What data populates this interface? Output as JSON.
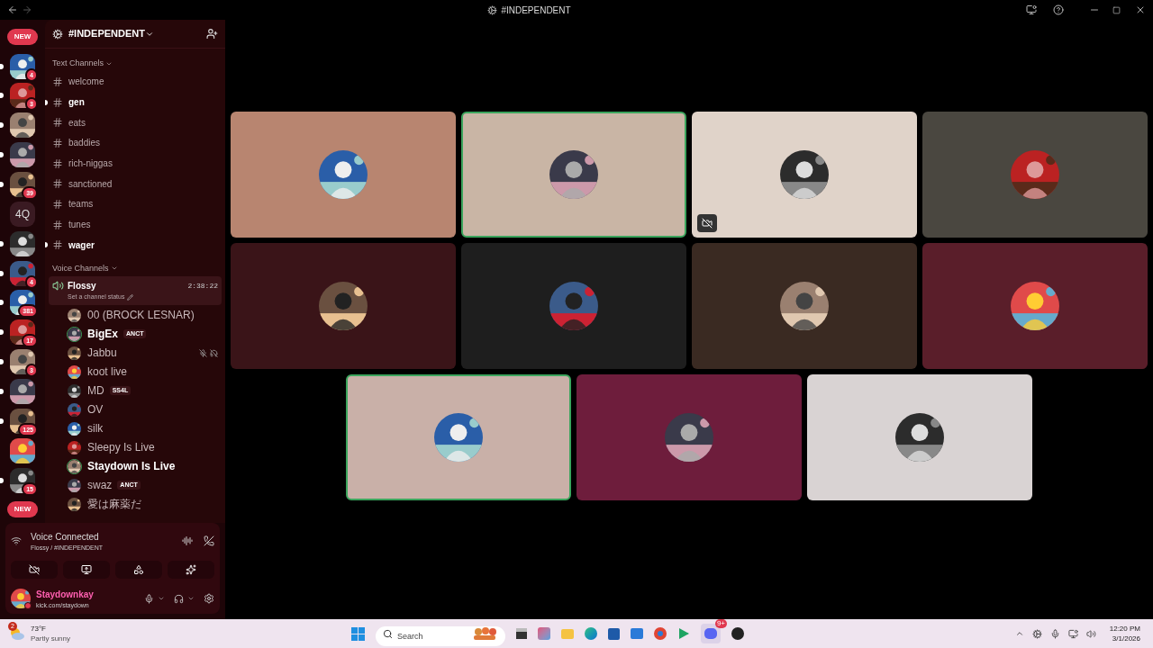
{
  "window": {
    "title": "#INDEPENDENT"
  },
  "servers": [
    {
      "kind": "pill",
      "label": "NEW",
      "unread": false
    },
    {
      "kind": "avatar",
      "badge": "4",
      "unread": true
    },
    {
      "kind": "avatar",
      "badge": "3",
      "unread": true
    },
    {
      "kind": "avatar",
      "unread": true
    },
    {
      "kind": "avatar",
      "unread": true
    },
    {
      "kind": "avatar",
      "badge": "39",
      "unread": true
    },
    {
      "kind": "text",
      "label": "4Q",
      "unread": false
    },
    {
      "kind": "avatar",
      "unread": true
    },
    {
      "kind": "avatar",
      "badge": "4",
      "unread": true
    },
    {
      "kind": "avatar",
      "badge": "381",
      "unread": true
    },
    {
      "kind": "avatar",
      "badge": "17",
      "unread": true
    },
    {
      "kind": "avatar",
      "badge": "3",
      "unread": true
    },
    {
      "kind": "avatar",
      "unread": true
    },
    {
      "kind": "avatar",
      "badge": "125",
      "unread": true
    },
    {
      "kind": "avatar",
      "unread": false
    },
    {
      "kind": "avatar",
      "badge": "15",
      "unread": true
    },
    {
      "kind": "pill",
      "label": "NEW",
      "unread": false
    }
  ],
  "server": {
    "name": "#INDEPENDENT"
  },
  "text_channels": {
    "heading": "Text Channels",
    "channels": [
      {
        "name": "welcome",
        "unread": false
      },
      {
        "name": "gen",
        "unread": true
      },
      {
        "name": "eats",
        "unread": false
      },
      {
        "name": "baddies",
        "unread": false
      },
      {
        "name": "rich-niggas",
        "unread": false
      },
      {
        "name": "sanctioned",
        "unread": false
      },
      {
        "name": "teams",
        "unread": false
      },
      {
        "name": "tunes",
        "unread": false
      },
      {
        "name": "wager",
        "unread": true
      }
    ]
  },
  "voice_channels": {
    "heading": "Voice Channels",
    "channel": {
      "name": "Flossy",
      "timer": "2:38:22",
      "status_hint": "Set a channel status"
    },
    "members": [
      {
        "name": "00 (BROCK LESNAR)",
        "speaking": false,
        "muted": false
      },
      {
        "name": "BigEx",
        "tag": "ANCT",
        "speaking": true,
        "muted": false
      },
      {
        "name": "Jabbu",
        "speaking": false,
        "muted": true
      },
      {
        "name": "koot live",
        "speaking": false,
        "muted": false
      },
      {
        "name": "MD",
        "tag": "SS4L",
        "speaking": false,
        "muted": false
      },
      {
        "name": "OV",
        "speaking": false,
        "muted": false
      },
      {
        "name": "silk",
        "speaking": false,
        "muted": false
      },
      {
        "name": "Sleepy Is Live",
        "speaking": false,
        "muted": false
      },
      {
        "name": "Staydown Is Live",
        "speaking": true,
        "muted": false
      },
      {
        "name": "swaz",
        "tag": "ANCT",
        "speaking": false,
        "muted": false
      },
      {
        "name": "愛は麻薬だ",
        "speaking": false,
        "muted": false
      }
    ]
  },
  "voice_panel": {
    "status": "Voice Connected",
    "location": "Flossy / #INDEPENDENT"
  },
  "user": {
    "name": "Staydownkay",
    "activity": "kick.com/staydown"
  },
  "tiles": [
    {
      "color": "#b88570",
      "speaking": false,
      "stream_off": false
    },
    {
      "color": "#c9b5a5",
      "speaking": true,
      "stream_off": false
    },
    {
      "color": "#e0d3c9",
      "speaking": false,
      "stream_off": true
    },
    {
      "color": "#4a4740",
      "speaking": false,
      "stream_off": false
    },
    {
      "color": "#3a1418",
      "speaking": false,
      "stream_off": false
    },
    {
      "color": "#1e1e1e",
      "speaking": false,
      "stream_off": false
    },
    {
      "color": "#3a2a22",
      "speaking": false,
      "stream_off": false
    },
    {
      "color": "#5a1e2a",
      "speaking": false,
      "stream_off": false
    },
    {
      "color": "#c9b0a8",
      "speaking": true,
      "stream_off": false
    },
    {
      "color": "#6e1d3c",
      "speaking": false,
      "stream_off": false
    },
    {
      "color": "#d9d3d3",
      "speaking": false,
      "stream_off": false
    }
  ],
  "taskbar": {
    "weather": {
      "badge": "2",
      "temperature": "73°F",
      "condition": "Partly sunny"
    },
    "search": {
      "placeholder": "Search"
    },
    "discord_badge": "9+",
    "clock": {
      "time": "12:20 PM",
      "date": "3/1/2026"
    }
  }
}
